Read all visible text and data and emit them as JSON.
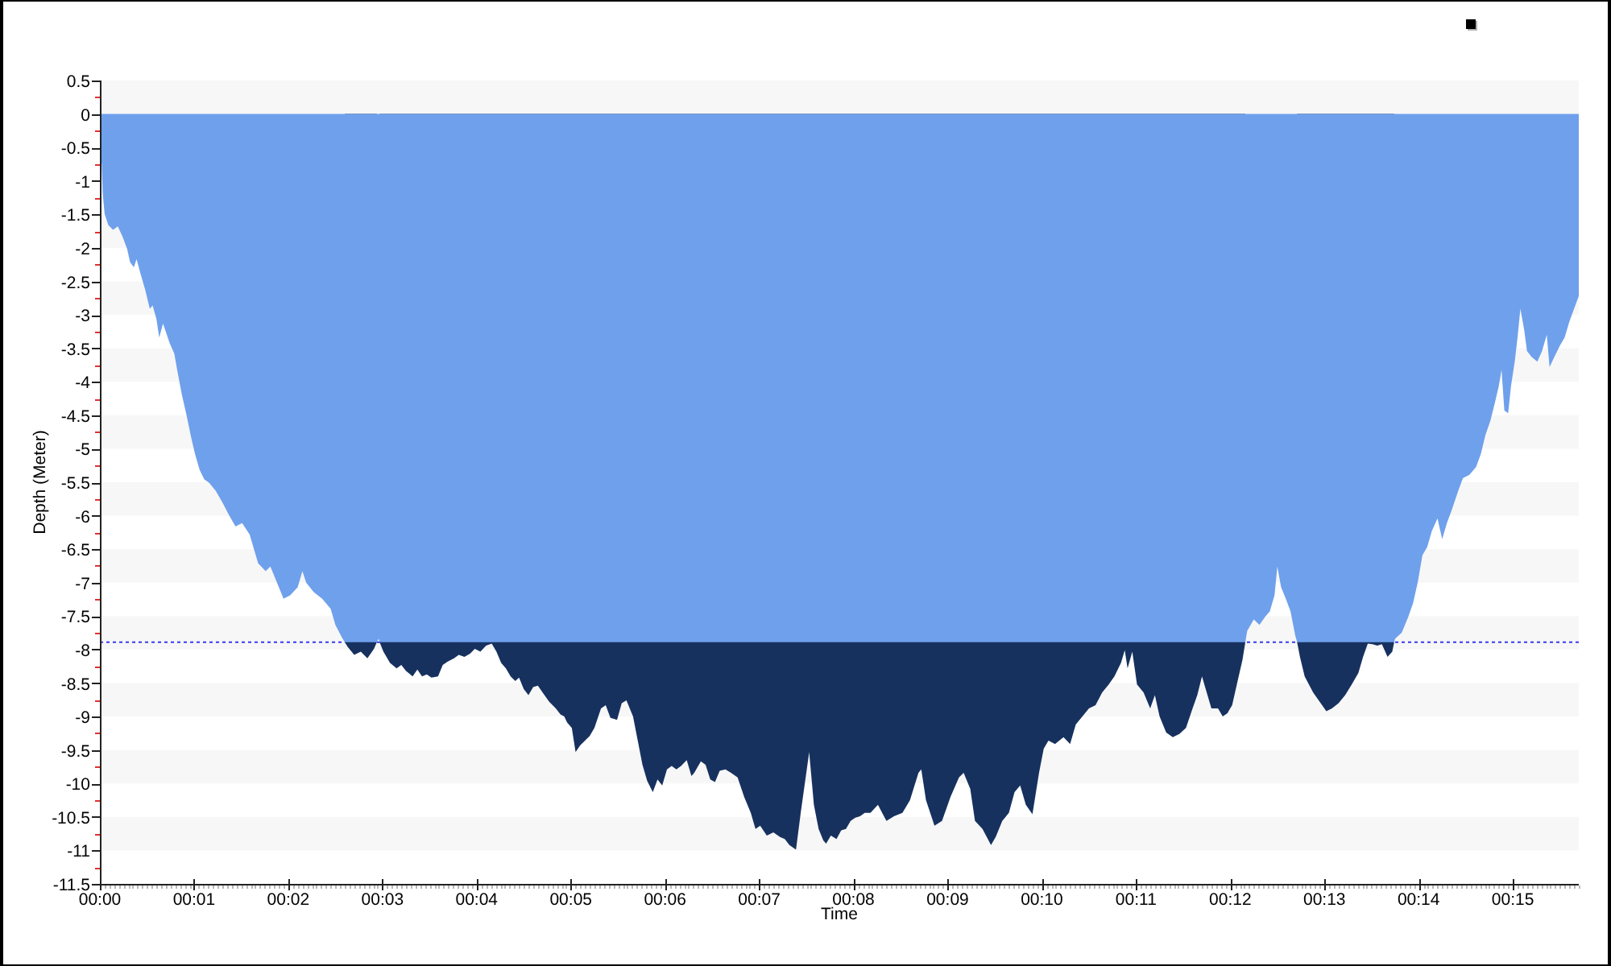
{
  "chart": {
    "chart_data": {
      "type": "area",
      "xlabel": "Time",
      "ylabel": "Depth (Meter)",
      "x": [
        0,
        0.02,
        0.03,
        0.05,
        0.09,
        0.14,
        0.19,
        0.24,
        0.29,
        0.32,
        0.36,
        0.39,
        0.43,
        0.48,
        0.53,
        0.56,
        0.6,
        0.63,
        0.67,
        0.7,
        0.74,
        0.79,
        0.82,
        0.87,
        0.92,
        0.97,
        1.01,
        1.06,
        1.11,
        1.16,
        1.23,
        1.3,
        1.37,
        1.44,
        1.51,
        1.59,
        1.68,
        1.76,
        1.81,
        1.88,
        1.95,
        2.02,
        2.1,
        2.15,
        2.19,
        2.27,
        2.36,
        2.45,
        2.5,
        2.57,
        2.6,
        2.63,
        2.7,
        2.77,
        2.84,
        2.91,
        2.94,
        2.96,
        2.97,
        3.01,
        3.08,
        3.15,
        3.2,
        3.25,
        3.32,
        3.37,
        3.42,
        3.47,
        3.52,
        3.59,
        3.64,
        3.69,
        3.76,
        3.81,
        3.87,
        3.93,
        3.98,
        4.04,
        4.1,
        4.16,
        4.21,
        4.26,
        4.31,
        4.36,
        4.41,
        4.45,
        4.5,
        4.55,
        4.6,
        4.65,
        4.7,
        4.77,
        4.84,
        4.89,
        4.93,
        4.96,
        5.01,
        5.05,
        5.1,
        5.15,
        5.2,
        5.25,
        5.32,
        5.37,
        5.42,
        5.49,
        5.54,
        5.59,
        5.66,
        5.71,
        5.76,
        5.81,
        5.87,
        5.92,
        5.97,
        6.02,
        6.07,
        6.12,
        6.17,
        6.23,
        6.28,
        6.31,
        6.38,
        6.43,
        6.48,
        6.53,
        6.58,
        6.64,
        6.7,
        6.77,
        6.84,
        6.91,
        6.96,
        7.01,
        7.08,
        7.15,
        7.22,
        7.27,
        7.32,
        7.39,
        7.44,
        7.53,
        7.58,
        7.63,
        7.68,
        7.71,
        7.76,
        7.82,
        7.87,
        7.92,
        7.97,
        8.02,
        8.07,
        8.12,
        8.18,
        8.26,
        8.35,
        8.43,
        8.52,
        8.6,
        8.69,
        8.72,
        8.77,
        8.86,
        8.94,
        9.03,
        9.12,
        9.17,
        9.24,
        9.29,
        9.37,
        9.46,
        9.51,
        9.58,
        9.65,
        9.71,
        9.77,
        9.83,
        9.9,
        9.97,
        10.02,
        10.07,
        10.14,
        10.23,
        10.3,
        10.36,
        10.43,
        10.5,
        10.57,
        10.64,
        10.71,
        10.77,
        10.84,
        10.88,
        10.91,
        10.96,
        11.01,
        11.08,
        11.15,
        11.2,
        11.25,
        11.32,
        11.39,
        11.46,
        11.53,
        11.6,
        11.65,
        11.7,
        11.75,
        11.8,
        11.87,
        11.92,
        11.97,
        12.02,
        12.07,
        12.13,
        12.16,
        12.18,
        12.25,
        12.31,
        12.37,
        12.42,
        12.47,
        12.5,
        12.54,
        12.59,
        12.64,
        12.69,
        12.71,
        12.74,
        12.79,
        12.88,
        12.96,
        13.02,
        13.08,
        13.15,
        13.22,
        13.29,
        13.36,
        13.41,
        13.46,
        13.51,
        13.56,
        13.61,
        13.67,
        13.72,
        13.74,
        13.75,
        13.82,
        13.89,
        13.94,
        13.99,
        14.04,
        14.09,
        14.14,
        14.2,
        14.25,
        14.3,
        14.35,
        14.42,
        14.47,
        14.54,
        14.61,
        14.66,
        14.71,
        14.76,
        14.81,
        14.85,
        14.88,
        14.91,
        14.95,
        14.98,
        15.02,
        15.05,
        15.08,
        15.12,
        15.15,
        15.2,
        15.26,
        15.31,
        15.36,
        15.39,
        15.44,
        15.5,
        15.55,
        15.6,
        15.65,
        15.7
      ],
      "series": [
        {
          "color": "#17315f",
          "values": [
            null,
            null,
            null,
            null,
            null,
            null,
            null,
            null,
            null,
            null,
            null,
            null,
            null,
            null,
            null,
            null,
            null,
            null,
            null,
            null,
            null,
            null,
            null,
            null,
            null,
            null,
            null,
            null,
            null,
            null,
            null,
            null,
            null,
            null,
            null,
            null,
            null,
            null,
            null,
            null,
            null,
            null,
            null,
            null,
            null,
            null,
            null,
            null,
            null,
            null,
            -7.89,
            -7.96,
            -8.08,
            -8.03,
            -8.13,
            -7.99,
            -7.89,
            null,
            -7.89,
            -8.03,
            -8.2,
            -8.28,
            -8.23,
            -8.32,
            -8.4,
            -8.3,
            -8.4,
            -8.37,
            -8.42,
            -8.4,
            -8.23,
            -8.18,
            -8.13,
            -8.08,
            -8.11,
            -8.06,
            -7.99,
            -8.03,
            -7.94,
            -7.91,
            -8.03,
            -8.2,
            -8.28,
            -8.4,
            -8.47,
            -8.42,
            -8.59,
            -8.68,
            -8.56,
            -8.54,
            -8.64,
            -8.78,
            -8.88,
            -8.97,
            -9,
            -9.09,
            -9.17,
            -9.53,
            -9.43,
            -9.36,
            -9.29,
            -9.17,
            -8.88,
            -8.83,
            -9.02,
            -9.05,
            -8.8,
            -8.76,
            -9,
            -9.36,
            -9.72,
            -9.96,
            -10.13,
            -9.94,
            -10.03,
            -9.79,
            -9.74,
            -9.79,
            -9.74,
            -9.65,
            -9.89,
            -9.84,
            -9.67,
            -9.72,
            -9.94,
            -9.98,
            -9.81,
            -9.79,
            -9.84,
            -9.91,
            -10.2,
            -10.44,
            -10.68,
            -10.63,
            -10.78,
            -10.73,
            -10.8,
            -10.83,
            -10.92,
            -10.99,
            -10.44,
            -9.53,
            -10.32,
            -10.68,
            -10.85,
            -10.9,
            -10.78,
            -10.83,
            -10.7,
            -10.68,
            -10.56,
            -10.51,
            -10.49,
            -10.44,
            -10.44,
            -10.32,
            -10.56,
            -10.49,
            -10.44,
            -10.25,
            -9.84,
            -9.79,
            -10.25,
            -10.63,
            -10.56,
            -10.2,
            -9.91,
            -9.84,
            -10.08,
            -10.56,
            -10.68,
            -10.92,
            -10.8,
            -10.56,
            -10.44,
            -10.13,
            -10.03,
            -10.32,
            -10.46,
            -9.84,
            -9.48,
            -9.36,
            -9.41,
            -9.31,
            -9.41,
            -9.12,
            -9,
            -8.88,
            -8.83,
            -8.64,
            -8.52,
            -8.4,
            -8.2,
            -8.01,
            -8.28,
            -8.03,
            -8.52,
            -8.64,
            -8.88,
            -8.68,
            -9,
            -9.24,
            -9.31,
            -9.26,
            -9.17,
            -8.88,
            -8.68,
            -8.4,
            -8.64,
            -8.88,
            -8.88,
            -9,
            -8.95,
            -8.83,
            -8.52,
            -8.15,
            -7.89,
            null,
            null,
            null,
            null,
            null,
            null,
            null,
            null,
            null,
            null,
            null,
            -7.89,
            -8.11,
            -8.4,
            -8.64,
            -8.8,
            -8.92,
            -8.88,
            -8.8,
            -8.68,
            -8.52,
            -8.35,
            -8.11,
            -7.91,
            -7.92,
            -7.94,
            -7.92,
            -8.11,
            -8.03,
            -7.89,
            null,
            null,
            null,
            null,
            null,
            null,
            null,
            null,
            null,
            null,
            null,
            null,
            null,
            null,
            null,
            null,
            null,
            null,
            null,
            null,
            null,
            null,
            null,
            null,
            null,
            null,
            null,
            null,
            null,
            null,
            null,
            null,
            null,
            null,
            null,
            null,
            null,
            null,
            null,
            null,
            null
          ]
        },
        {
          "color": "#6fa0ec",
          "values": [
            -0.41,
            -0.77,
            -1.18,
            -1.49,
            -1.66,
            -1.73,
            -1.68,
            -1.83,
            -2.02,
            -2.21,
            -2.29,
            -2.17,
            -2.38,
            -2.62,
            -2.91,
            -2.86,
            -3.06,
            -3.34,
            -3.13,
            -3.25,
            -3.42,
            -3.58,
            -3.82,
            -4.19,
            -4.5,
            -4.84,
            -5.08,
            -5.32,
            -5.46,
            -5.51,
            -5.63,
            -5.8,
            -5.99,
            -6.16,
            -6.11,
            -6.28,
            -6.71,
            -6.83,
            -6.76,
            -7,
            -7.24,
            -7.19,
            -7.07,
            -6.83,
            -7,
            -7.14,
            -7.24,
            -7.39,
            -7.63,
            -7.82,
            -7.89,
            -7.89,
            -7.89,
            -7.89,
            -7.89,
            -7.89,
            -7.89,
            -7.84,
            -7.89,
            -7.89,
            -7.89,
            -7.89,
            -7.89,
            -7.89,
            -7.89,
            -7.89,
            -7.89,
            -7.89,
            -7.89,
            -7.89,
            -7.89,
            -7.89,
            -7.89,
            -7.89,
            -7.89,
            -7.89,
            -7.89,
            -7.89,
            -7.89,
            -7.89,
            -7.89,
            -7.89,
            -7.89,
            -7.89,
            -7.89,
            -7.89,
            -7.89,
            -7.89,
            -7.89,
            -7.89,
            -7.89,
            -7.89,
            -7.89,
            -7.89,
            -7.89,
            -7.89,
            -7.89,
            -7.89,
            -7.89,
            -7.89,
            -7.89,
            -7.89,
            -7.89,
            -7.89,
            -7.89,
            -7.89,
            -7.89,
            -7.89,
            -7.89,
            -7.89,
            -7.89,
            -7.89,
            -7.89,
            -7.89,
            -7.89,
            -7.89,
            -7.89,
            -7.89,
            -7.89,
            -7.89,
            -7.89,
            -7.89,
            -7.89,
            -7.89,
            -7.89,
            -7.89,
            -7.89,
            -7.89,
            -7.89,
            -7.89,
            -7.89,
            -7.89,
            -7.89,
            -7.89,
            -7.89,
            -7.89,
            -7.89,
            -7.89,
            -7.89,
            -7.89,
            -7.89,
            -7.89,
            -7.89,
            -7.89,
            -7.89,
            -7.89,
            -7.89,
            -7.89,
            -7.89,
            -7.89,
            -7.89,
            -7.89,
            -7.89,
            -7.89,
            -7.89,
            -7.89,
            -7.89,
            -7.89,
            -7.89,
            -7.89,
            -7.89,
            -7.89,
            -7.89,
            -7.89,
            -7.89,
            -7.89,
            -7.89,
            -7.89,
            -7.89,
            -7.89,
            -7.89,
            -7.89,
            -7.89,
            -7.89,
            -7.89,
            -7.89,
            -7.89,
            -7.89,
            -7.89,
            -7.89,
            -7.89,
            -7.89,
            -7.89,
            -7.89,
            -7.89,
            -7.89,
            -7.89,
            -7.89,
            -7.89,
            -7.89,
            -7.89,
            -7.89,
            -7.89,
            -7.89,
            -7.89,
            -7.89,
            -7.89,
            -7.89,
            -7.89,
            -7.89,
            -7.89,
            -7.89,
            -7.89,
            -7.89,
            -7.89,
            -7.89,
            -7.89,
            -7.89,
            -7.89,
            -7.89,
            -7.89,
            -7.89,
            -7.89,
            -7.89,
            -7.89,
            -7.89,
            -7.89,
            -7.72,
            -7.55,
            -7.63,
            -7.51,
            -7.43,
            -7.19,
            -6.76,
            -7.07,
            -7.24,
            -7.43,
            -7.79,
            -7.89,
            -7.89,
            -7.89,
            -7.89,
            -7.89,
            -7.89,
            -7.89,
            -7.89,
            -7.89,
            -7.89,
            -7.89,
            -7.89,
            -7.89,
            -7.89,
            -7.89,
            -7.89,
            -7.89,
            -7.89,
            -7.89,
            -7.84,
            -7.75,
            -7.51,
            -7.31,
            -7,
            -6.59,
            -6.47,
            -6.23,
            -6.04,
            -6.35,
            -6.11,
            -5.92,
            -5.63,
            -5.44,
            -5.39,
            -5.27,
            -5.08,
            -4.79,
            -4.59,
            -4.31,
            -4.07,
            -3.82,
            -4.43,
            -4.47,
            -4.07,
            -3.7,
            -3.34,
            -2.91,
            -3.22,
            -3.54,
            -3.63,
            -3.7,
            -3.54,
            -3.3,
            -3.78,
            -3.63,
            -3.46,
            -3.34,
            -3.1,
            -2.91,
            -2.72
          ]
        }
      ],
      "xlim": [
        0,
        15.7
      ],
      "ylim": [
        -11.5,
        0.5
      ],
      "xticks": [
        {
          "value": 0,
          "label": "00:00"
        },
        {
          "value": 1,
          "label": "00:01"
        },
        {
          "value": 2,
          "label": "00:02"
        },
        {
          "value": 3,
          "label": "00:03"
        },
        {
          "value": 4,
          "label": "00:04"
        },
        {
          "value": 5,
          "label": "00:05"
        },
        {
          "value": 6,
          "label": "00:06"
        },
        {
          "value": 7,
          "label": "00:07"
        },
        {
          "value": 8,
          "label": "00:08"
        },
        {
          "value": 9,
          "label": "00:09"
        },
        {
          "value": 10,
          "label": "00:10"
        },
        {
          "value": 11,
          "label": "00:11"
        },
        {
          "value": 12,
          "label": "00:12"
        },
        {
          "value": 13,
          "label": "00:13"
        },
        {
          "value": 14,
          "label": "00:14"
        },
        {
          "value": 15,
          "label": "00:15"
        }
      ],
      "yticks": [
        0.5,
        0,
        -0.5,
        -1,
        -1.5,
        -2,
        -2.5,
        -3,
        -3.5,
        -4,
        -4.5,
        -5,
        -5.5,
        -6,
        -6.5,
        -7,
        -7.5,
        -8,
        -8.5,
        -9,
        -9.5,
        -10,
        -10.5,
        -11,
        -11.5
      ],
      "ref_lines": [
        {
          "axis": "y",
          "value": -7.89,
          "color": "#3a3af0"
        }
      ]
    }
  }
}
